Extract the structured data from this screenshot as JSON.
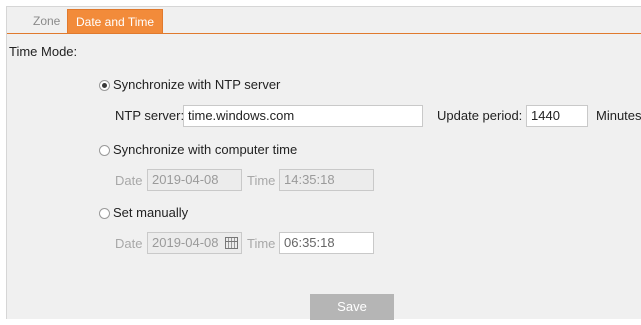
{
  "tabs": [
    {
      "label": "Zone",
      "active": false
    },
    {
      "label": "Date and Time",
      "active": true
    }
  ],
  "time_mode_label": "Time Mode:",
  "ntp": {
    "option_label": "Synchronize with NTP server",
    "selected": true,
    "server_label": "NTP server:",
    "server_value": "time.windows.com",
    "update_label": "Update period:",
    "update_value": "1440",
    "unit": "Minutes"
  },
  "computer_time": {
    "option_label": "Synchronize with computer time",
    "selected": false,
    "date_label": "Date",
    "date_value": "2019-04-08",
    "time_label": "Time",
    "time_value": "14:35:18"
  },
  "manual": {
    "option_label": "Set manually",
    "selected": false,
    "date_label": "Date",
    "date_value": "2019-04-08",
    "time_label": "Time",
    "time_value": "06:35:18"
  },
  "save_label": "Save",
  "colors": {
    "accent": "#f28b3a",
    "accent_border": "#e07a2e",
    "panel_bg": "#f0f0f0",
    "button_bg": "#b5b5b5"
  }
}
